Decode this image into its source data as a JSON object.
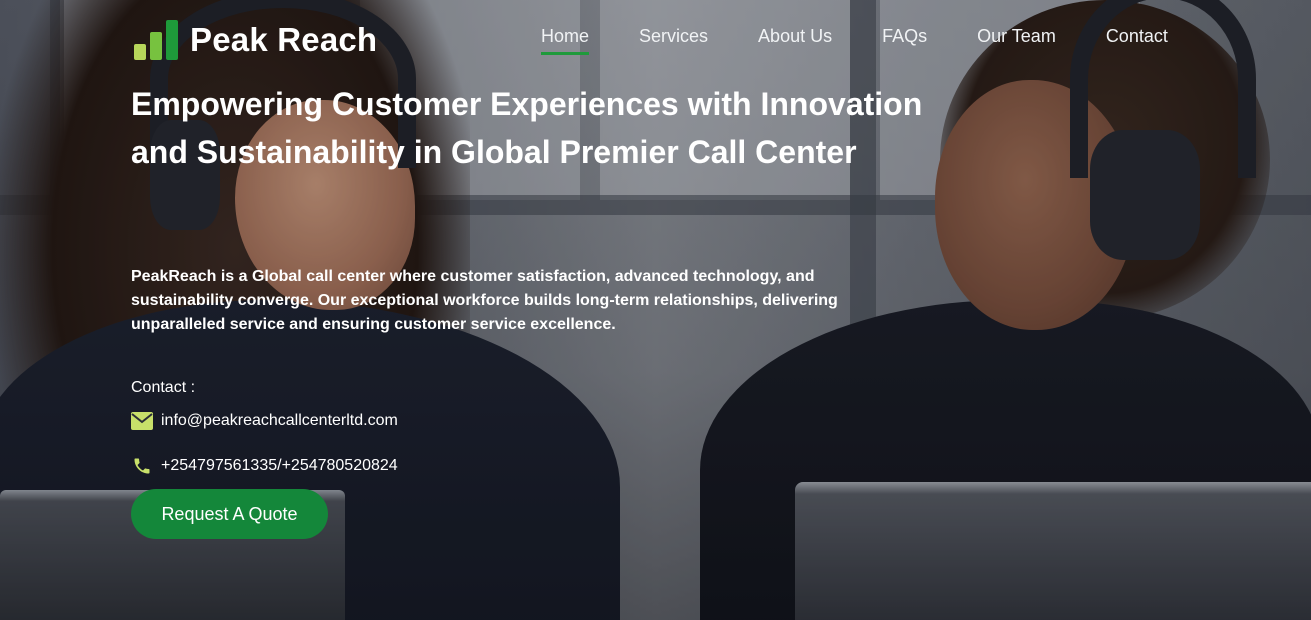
{
  "brand": {
    "name": "Peak Reach"
  },
  "nav": {
    "items": [
      {
        "label": "Home",
        "active": true
      },
      {
        "label": "Services",
        "active": false
      },
      {
        "label": "About Us",
        "active": false
      },
      {
        "label": "FAQs",
        "active": false
      },
      {
        "label": "Our Team",
        "active": false
      },
      {
        "label": "Contact",
        "active": false
      }
    ]
  },
  "hero": {
    "title": "Empowering Customer Experiences with Innovation and Sustainability in Global Premier Call Center",
    "description": "PeakReach is a Global call center where customer satisfaction, advanced technology, and sustainability converge. Our exceptional workforce builds long-term relationships, delivering unparalleled service and ensuring customer service excellence.",
    "contact_label": "Contact :",
    "email": "info@peakreachcallcenterltd.com",
    "phone": "+254797561335/+254780520824",
    "cta_label": "Request A Quote"
  },
  "icons": {
    "logo": "bar-chart-logo-icon",
    "email": "envelope-icon",
    "phone": "phone-icon"
  },
  "colors": {
    "accent": "#1f9a3b",
    "button": "#14873a",
    "icon": "#c8e06a"
  }
}
